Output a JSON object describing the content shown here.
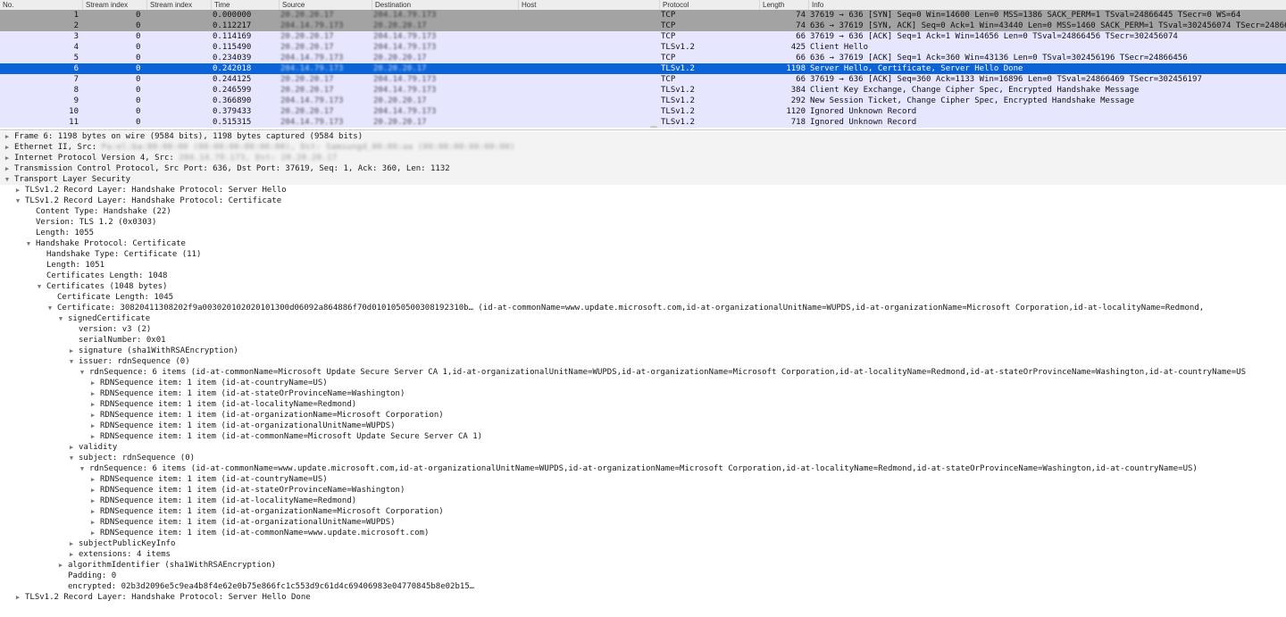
{
  "columns": {
    "no": "No.",
    "stream_index": "Stream index",
    "stream_index2": "Stream index",
    "time": "Time",
    "source": "Source",
    "destination": "Destination",
    "host": "Host",
    "protocol": "Protocol",
    "length": "Length",
    "info": "Info"
  },
  "packets": [
    {
      "no": "1",
      "si": "0",
      "time": "0.000000",
      "src": "20.20.20.17",
      "dst": "204.14.79.173",
      "host": "",
      "proto": "TCP",
      "len": "74",
      "info": "37619 → 636 [SYN] Seq=0 Win=14600 Len=0 MSS=1386 SACK_PERM=1 TSval=24866445 TSecr=0 WS=64",
      "style": "grey"
    },
    {
      "no": "2",
      "si": "0",
      "time": "0.112217",
      "src": "204.14.79.173",
      "dst": "20.20.20.17",
      "host": "",
      "proto": "TCP",
      "len": "74",
      "info": "636 → 37619 [SYN, ACK] Seq=0 Ack=1 Win=43440 Len=0 MSS=1460 SACK_PERM=1 TSval=302456074 TSecr=24866445",
      "style": "grey"
    },
    {
      "no": "3",
      "si": "0",
      "time": "0.114169",
      "src": "20.20.20.17",
      "dst": "204.14.79.173",
      "host": "",
      "proto": "TCP",
      "len": "66",
      "info": "37619 → 636 [ACK] Seq=1 Ack=1 Win=14656 Len=0 TSval=24866456 TSecr=302456074",
      "style": "lav"
    },
    {
      "no": "4",
      "si": "0",
      "time": "0.115490",
      "src": "20.20.20.17",
      "dst": "204.14.79.173",
      "host": "",
      "proto": "TLSv1.2",
      "len": "425",
      "info": "Client Hello",
      "style": "lav"
    },
    {
      "no": "5",
      "si": "0",
      "time": "0.234039",
      "src": "204.14.79.173",
      "dst": "20.20.20.17",
      "host": "",
      "proto": "TCP",
      "len": "66",
      "info": "636 → 37619 [ACK] Seq=1 Ack=360 Win=43136 Len=0 TSval=302456196 TSecr=24866456",
      "style": "lav"
    },
    {
      "no": "6",
      "si": "0",
      "time": "0.242018",
      "src": "204.14.79.173",
      "dst": "20.20.20.17",
      "host": "",
      "proto": "TLSv1.2",
      "len": "1198",
      "info": "Server Hello, Certificate, Server Hello Done",
      "style": "sel"
    },
    {
      "no": "7",
      "si": "0",
      "time": "0.244125",
      "src": "20.20.20.17",
      "dst": "204.14.79.173",
      "host": "",
      "proto": "TCP",
      "len": "66",
      "info": "37619 → 636 [ACK] Seq=360 Ack=1133 Win=16896 Len=0 TSval=24866469 TSecr=302456197",
      "style": "lav"
    },
    {
      "no": "8",
      "si": "0",
      "time": "0.246599",
      "src": "20.20.20.17",
      "dst": "204.14.79.173",
      "host": "",
      "proto": "TLSv1.2",
      "len": "384",
      "info": "Client Key Exchange, Change Cipher Spec, Encrypted Handshake Message",
      "style": "lav"
    },
    {
      "no": "9",
      "si": "0",
      "time": "0.366890",
      "src": "204.14.79.173",
      "dst": "20.20.20.17",
      "host": "",
      "proto": "TLSv1.2",
      "len": "292",
      "info": "New Session Ticket, Change Cipher Spec, Encrypted Handshake Message",
      "style": "lav"
    },
    {
      "no": "10",
      "si": "0",
      "time": "0.379433",
      "src": "20.20.20.17",
      "dst": "204.14.79.173",
      "host": "",
      "proto": "TLSv1.2",
      "len": "1120",
      "info": "Ignored Unknown Record",
      "style": "lav"
    },
    {
      "no": "11",
      "si": "0",
      "time": "0.515315",
      "src": "204.14.79.173",
      "dst": "20.20.20.17",
      "host": "",
      "proto": "TLSv1.2",
      "len": "718",
      "info": "Ignored Unknown Record",
      "style": "lav"
    }
  ],
  "details": [
    {
      "level": 0,
      "toggle": "collapsed",
      "text": "Frame 6: 1198 bytes on wire (9584 bits), 1198 bytes captured (9584 bits)",
      "bg": "grey"
    },
    {
      "level": 0,
      "toggle": "collapsed",
      "text": "Ethernet II, Src: ",
      "redacted": "Pa:el:ba:80:00:00 (00:00:00:00:00:00), Dst: Samsungd_00:00:aa (00:00:00:00:00:00)",
      "bg": "grey"
    },
    {
      "level": 0,
      "toggle": "collapsed",
      "text": "Internet Protocol Version 4, Src: ",
      "redacted": "204.14.79.173, Dst: 20.20.20.17",
      "bg": "grey"
    },
    {
      "level": 0,
      "toggle": "collapsed",
      "text": "Transmission Control Protocol, Src Port: 636, Dst Port: 37619, Seq: 1, Ack: 360, Len: 1132",
      "bg": "grey"
    },
    {
      "level": 0,
      "toggle": "expanded",
      "text": "Transport Layer Security",
      "bg": "grey"
    },
    {
      "level": 1,
      "toggle": "collapsed",
      "text": "TLSv1.2 Record Layer: Handshake Protocol: Server Hello"
    },
    {
      "level": 1,
      "toggle": "expanded",
      "text": "TLSv1.2 Record Layer: Handshake Protocol: Certificate"
    },
    {
      "level": 2,
      "toggle": "none",
      "text": "Content Type: Handshake (22)"
    },
    {
      "level": 2,
      "toggle": "none",
      "text": "Version: TLS 1.2 (0x0303)"
    },
    {
      "level": 2,
      "toggle": "none",
      "text": "Length: 1055"
    },
    {
      "level": 2,
      "toggle": "expanded",
      "text": "Handshake Protocol: Certificate"
    },
    {
      "level": 3,
      "toggle": "none",
      "text": "Handshake Type: Certificate (11)"
    },
    {
      "level": 3,
      "toggle": "none",
      "text": "Length: 1051"
    },
    {
      "level": 3,
      "toggle": "none",
      "text": "Certificates Length: 1048"
    },
    {
      "level": 3,
      "toggle": "expanded",
      "text": "Certificates (1048 bytes)"
    },
    {
      "level": 4,
      "toggle": "none",
      "text": "Certificate Length: 1045"
    },
    {
      "level": 4,
      "toggle": "expanded",
      "text": "Certificate: 30820411308202f9a003020102020101300d06092a864886f70d0101050500308192310b… (id-at-commonName=www.update.microsoft.com,id-at-organizationalUnitName=WUPDS,id-at-organizationName=Microsoft Corporation,id-at-localityName=Redmond,"
    },
    {
      "level": 5,
      "toggle": "expanded",
      "text": "signedCertificate"
    },
    {
      "level": 6,
      "toggle": "none",
      "text": "version: v3 (2)"
    },
    {
      "level": 6,
      "toggle": "none",
      "text": "serialNumber: 0x01"
    },
    {
      "level": 6,
      "toggle": "collapsed",
      "text": "signature (sha1WithRSAEncryption)"
    },
    {
      "level": 6,
      "toggle": "expanded",
      "text": "issuer: rdnSequence (0)"
    },
    {
      "level": 7,
      "toggle": "expanded",
      "text": "rdnSequence: 6 items (id-at-commonName=Microsoft Update Secure Server CA 1,id-at-organizationalUnitName=WUPDS,id-at-organizationName=Microsoft Corporation,id-at-localityName=Redmond,id-at-stateOrProvinceName=Washington,id-at-countryName=US"
    },
    {
      "level": 8,
      "toggle": "collapsed",
      "text": "RDNSequence item: 1 item (id-at-countryName=US)"
    },
    {
      "level": 8,
      "toggle": "collapsed",
      "text": "RDNSequence item: 1 item (id-at-stateOrProvinceName=Washington)"
    },
    {
      "level": 8,
      "toggle": "collapsed",
      "text": "RDNSequence item: 1 item (id-at-localityName=Redmond)"
    },
    {
      "level": 8,
      "toggle": "collapsed",
      "text": "RDNSequence item: 1 item (id-at-organizationName=Microsoft Corporation)"
    },
    {
      "level": 8,
      "toggle": "collapsed",
      "text": "RDNSequence item: 1 item (id-at-organizationalUnitName=WUPDS)"
    },
    {
      "level": 8,
      "toggle": "collapsed",
      "text": "RDNSequence item: 1 item (id-at-commonName=Microsoft Update Secure Server CA 1)"
    },
    {
      "level": 6,
      "toggle": "collapsed",
      "text": "validity"
    },
    {
      "level": 6,
      "toggle": "expanded",
      "text": "subject: rdnSequence (0)"
    },
    {
      "level": 7,
      "toggle": "expanded",
      "text": "rdnSequence: 6 items (id-at-commonName=www.update.microsoft.com,id-at-organizationalUnitName=WUPDS,id-at-organizationName=Microsoft Corporation,id-at-localityName=Redmond,id-at-stateOrProvinceName=Washington,id-at-countryName=US)"
    },
    {
      "level": 8,
      "toggle": "collapsed",
      "text": "RDNSequence item: 1 item (id-at-countryName=US)"
    },
    {
      "level": 8,
      "toggle": "collapsed",
      "text": "RDNSequence item: 1 item (id-at-stateOrProvinceName=Washington)"
    },
    {
      "level": 8,
      "toggle": "collapsed",
      "text": "RDNSequence item: 1 item (id-at-localityName=Redmond)"
    },
    {
      "level": 8,
      "toggle": "collapsed",
      "text": "RDNSequence item: 1 item (id-at-organizationName=Microsoft Corporation)"
    },
    {
      "level": 8,
      "toggle": "collapsed",
      "text": "RDNSequence item: 1 item (id-at-organizationalUnitName=WUPDS)"
    },
    {
      "level": 8,
      "toggle": "collapsed",
      "text": "RDNSequence item: 1 item (id-at-commonName=www.update.microsoft.com)"
    },
    {
      "level": 6,
      "toggle": "collapsed",
      "text": "subjectPublicKeyInfo"
    },
    {
      "level": 6,
      "toggle": "collapsed",
      "text": "extensions: 4 items"
    },
    {
      "level": 5,
      "toggle": "collapsed",
      "text": "algorithmIdentifier (sha1WithRSAEncryption)"
    },
    {
      "level": 5,
      "toggle": "none",
      "text": "Padding: 0"
    },
    {
      "level": 5,
      "toggle": "none",
      "text": "encrypted: 02b3d2096e5c9ea4b8f4e62e0b75e866fc1c553d9c61d4c69406983e04770845b8e02b15…"
    },
    {
      "level": 1,
      "toggle": "collapsed",
      "text": "TLSv1.2 Record Layer: Handshake Protocol: Server Hello Done"
    }
  ],
  "colors": {
    "grey_row": "#a3a3a3",
    "lavender_row": "#e7e6ff",
    "selected_row": "#0a64d8",
    "selected_text": "#ffffff",
    "header_bg": "#ededed"
  },
  "icons": {
    "collapsed": "disclosure-triangle-right-icon",
    "expanded": "disclosure-triangle-down-icon"
  }
}
